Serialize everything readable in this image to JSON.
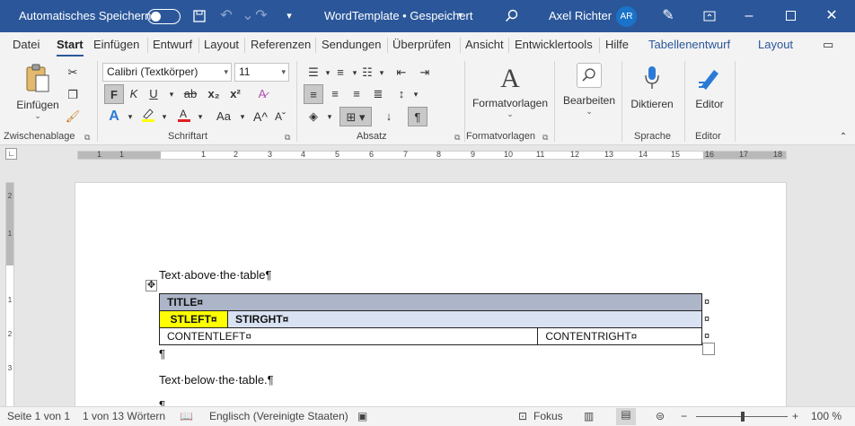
{
  "titlebar": {
    "autosave_label": "Automatisches Speichern",
    "doc_title": "WordTemplate • Gespeichert",
    "user_name": "Axel Richter",
    "user_initials": "AR"
  },
  "tabs": [
    {
      "label": "Datei"
    },
    {
      "label": "Start"
    },
    {
      "label": "Einfügen"
    },
    {
      "label": "Entwurf"
    },
    {
      "label": "Layout"
    },
    {
      "label": "Referenzen"
    },
    {
      "label": "Sendungen"
    },
    {
      "label": "Überprüfen"
    },
    {
      "label": "Ansicht"
    },
    {
      "label": "Entwicklertools"
    },
    {
      "label": "Hilfe"
    },
    {
      "label": "Tabellenentwurf"
    },
    {
      "label": "Layout"
    }
  ],
  "ribbon": {
    "paste_label": "Einfügen",
    "font_name": "Calibri (Textkörper)",
    "font_size": "11",
    "bold": "F",
    "italic": "K",
    "underline": "U",
    "strike": "ab",
    "subscript": "x₂",
    "superscript": "x²",
    "font_color_a": "A",
    "change_case": "Aa",
    "grow_font": "A^",
    "shrink_font": "Aˇ",
    "formatvorlagen_label": "Formatvorlagen",
    "bearbeiten_label": "Bearbeiten",
    "diktieren_label": "Diktieren",
    "editor_label": "Editor",
    "groups": {
      "zwischenablage": "Zwischenablage",
      "schriftart": "Schriftart",
      "absatz": "Absatz",
      "formatvorlagen": "Formatvorlagen",
      "sprache": "Sprache",
      "editor": "Editor"
    }
  },
  "ruler": {
    "labels": [
      "1",
      "2",
      "1",
      "1",
      "2",
      "3",
      "4",
      "5",
      "6",
      "7",
      "8",
      "9",
      "10",
      "11",
      "12",
      "13",
      "14",
      "15",
      "16",
      "17",
      "18"
    ]
  },
  "document": {
    "text_above": "Text·above·the·table¶",
    "table": {
      "title": "TITLE¤",
      "st_left": "STLEFT¤",
      "st_right": "STIRGHT¤",
      "content_left": "CONTENTLEFT¤",
      "content_right": "CONTENTRIGHT¤"
    },
    "row_end_mark": "¤",
    "pilcrow": "¶",
    "text_below": "Text·below·the·table.¶"
  },
  "status": {
    "page": "Seite 1 von 1",
    "words": "1 von 13 Wörtern",
    "language": "Englisch (Vereinigte Staaten)",
    "focus": "Fokus",
    "zoom": "100 %"
  },
  "colors": {
    "titlebar": "#2b579a",
    "title_row": "#adb5c9",
    "subtitle_row": "#d9e2f3",
    "highlight_yellow": "#ffff00"
  }
}
